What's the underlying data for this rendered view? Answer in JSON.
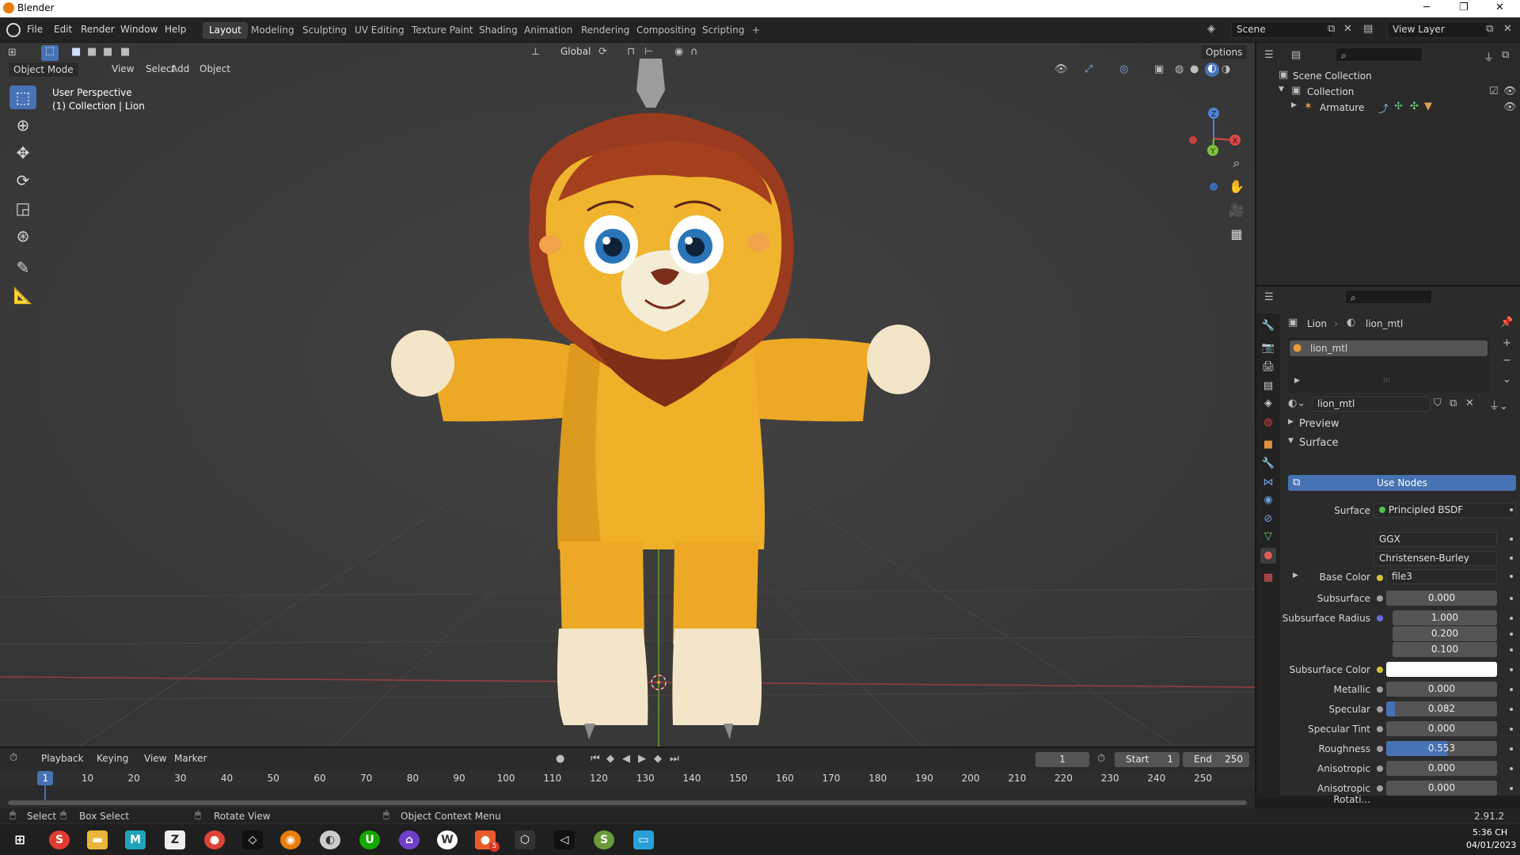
{
  "window": {
    "title": "Blender",
    "minimize": "─",
    "restore": "❐",
    "close": "✕"
  },
  "menu": [
    "File",
    "Edit",
    "Render",
    "Window",
    "Help"
  ],
  "workspaces": [
    "Layout",
    "Modeling",
    "Sculpting",
    "UV Editing",
    "Texture Paint",
    "Shading",
    "Animation",
    "Rendering",
    "Compositing",
    "Scripting",
    "+"
  ],
  "active_workspace": "Layout",
  "scene_field": "Scene",
  "view_layer_field": "View Layer",
  "viewport_header": {
    "transform_orientation": "Global",
    "options": "Options",
    "mode": "Object Mode",
    "menus": [
      "View",
      "Select",
      "Add",
      "Object"
    ]
  },
  "viewport_overlay": {
    "line1": "User Perspective",
    "line2": "(1) Collection | Lion"
  },
  "gizmo": {
    "x": "X",
    "y": "Y",
    "z": "Z"
  },
  "outliner": {
    "rows": [
      {
        "label": "Scene Collection"
      },
      {
        "label": "Collection"
      },
      {
        "label": "Armature"
      }
    ]
  },
  "properties": {
    "breadcrumb_object": "Lion",
    "breadcrumb_material": "lion_mtl",
    "slot_name": "lion_mtl",
    "material_field": "lion_mtl",
    "preview_panel": "Preview",
    "surface_panel": "Surface",
    "use_nodes_button": "Use Nodes",
    "surface_label": "Surface",
    "surface_value": "Principled BSDF",
    "distribution": "GGX",
    "subsurface_method": "Christensen-Burley",
    "base_color_label": "Base Color",
    "base_color_value": "file3",
    "params": [
      {
        "label": "Subsurface",
        "value": "0.000",
        "fill": 0
      },
      {
        "label": "Subsurface Radius",
        "value": "1.000",
        "fill": 0
      },
      {
        "label": "",
        "value": "0.200",
        "fill": 0
      },
      {
        "label": "",
        "value": "0.100",
        "fill": 0
      },
      {
        "label": "Subsurface Color",
        "value": "",
        "fill": 0,
        "color": "#ffffff"
      },
      {
        "label": "Metallic",
        "value": "0.000",
        "fill": 0
      },
      {
        "label": "Specular",
        "value": "0.082",
        "fill": 0.082
      },
      {
        "label": "Specular Tint",
        "value": "0.000",
        "fill": 0
      },
      {
        "label": "Roughness",
        "value": "0.553",
        "fill": 0.553
      },
      {
        "label": "Anisotropic",
        "value": "0.000",
        "fill": 0
      },
      {
        "label": "Anisotropic Rotati...",
        "value": "0.000",
        "fill": 0
      }
    ]
  },
  "timeline": {
    "menus": [
      "Playback",
      "Keying",
      "View",
      "Marker"
    ],
    "current_frame": "1",
    "start_label": "Start",
    "start_value": "1",
    "end_label": "End",
    "end_value": "250",
    "ruler": [
      "1",
      "10",
      "20",
      "30",
      "40",
      "50",
      "60",
      "70",
      "80",
      "90",
      "100",
      "110",
      "120",
      "130",
      "140",
      "150",
      "160",
      "170",
      "180",
      "190",
      "200",
      "210",
      "220",
      "230",
      "240",
      "250"
    ]
  },
  "statusbar": {
    "select": "Select",
    "box_select": "Box Select",
    "rotate_view": "Rotate View",
    "context_menu": "Object Context Menu",
    "version": "2.91.2"
  },
  "taskbar": {
    "time": "5:36 CH",
    "date": "04/01/2023",
    "badge": "5"
  },
  "colors": {
    "accent": "#4772b3",
    "viewport_bg": "#3a3a3a",
    "lion_body": "#f0b02a",
    "lion_mane": "#9a3a1e",
    "lion_paws": "#f3e6c8"
  }
}
